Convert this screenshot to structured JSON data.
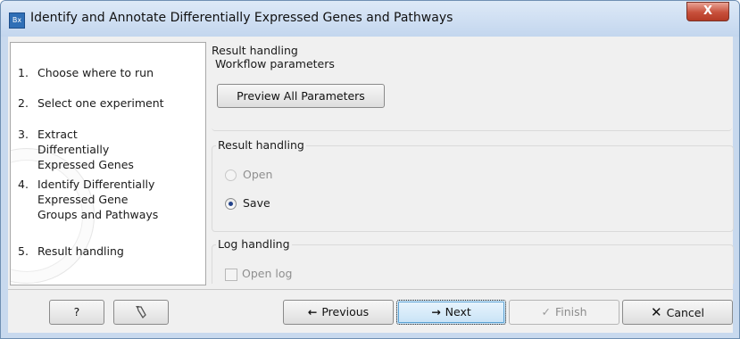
{
  "window": {
    "title": "Identify and Annotate Differentially Expressed Genes and Pathways",
    "app_icon_text": "Bx",
    "close_symbol": "X"
  },
  "steps": [
    {
      "num": "1.",
      "label": "Choose where to run"
    },
    {
      "num": "2.",
      "label": "Select one experiment"
    },
    {
      "num": "3.",
      "label": "Extract Differentially Expressed Genes"
    },
    {
      "num": "4.",
      "label": "Identify Differentially Expressed Gene Groups and Pathways"
    },
    {
      "num": "5.",
      "label": "Result handling"
    }
  ],
  "main": {
    "title": "Result handling",
    "workflow_parameters": {
      "label": "Workflow parameters",
      "button": "Preview All Parameters"
    },
    "result_handling": {
      "label": "Result handling",
      "options": [
        {
          "label": "Open",
          "selected": false,
          "enabled": false
        },
        {
          "label": "Save",
          "selected": true,
          "enabled": true
        }
      ]
    },
    "log_handling": {
      "label": "Log handling",
      "checkbox": {
        "label": "Open log",
        "checked": false,
        "enabled": false
      }
    }
  },
  "footer": {
    "help": "?",
    "reset_icon": "reset-icon",
    "previous": "Previous",
    "previous_icon": "←",
    "next": "Next",
    "next_icon": "→",
    "finish": "Finish",
    "finish_icon": "✓",
    "cancel": "Cancel",
    "cancel_icon": "✕"
  }
}
